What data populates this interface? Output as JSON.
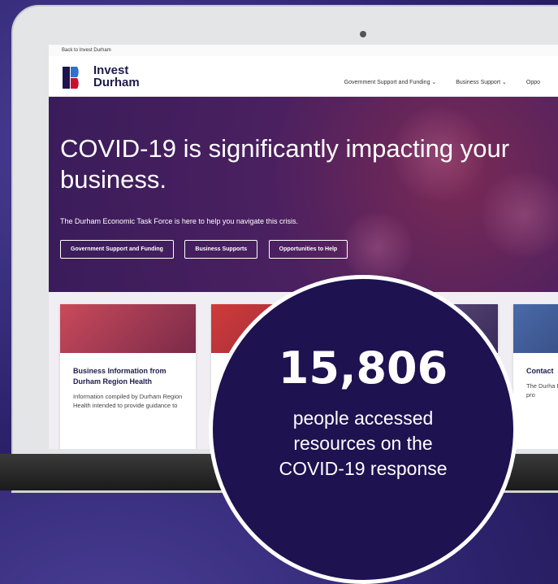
{
  "topbar": {
    "back_link": "Back to Invest Durham"
  },
  "logo": {
    "line1": "Invest",
    "line2": "Durham"
  },
  "nav": {
    "items": [
      "Government Support and Funding ⌄",
      "Business Support ⌄",
      "Oppo"
    ]
  },
  "hero": {
    "title": "COVID-19 is significantly impacting your business.",
    "subtitle": "The Durham Economic Task Force is here to help you navigate this crisis.",
    "buttons": [
      "Government Support and Funding",
      "Business Supports",
      "Opportunities to Help"
    ]
  },
  "cards": [
    {
      "title": "Business Information from Durham Region Health",
      "body": "Information compiled by Durham Region Health intended to provide guidance to"
    },
    {
      "title": "Contact",
      "body": "The Durha Force is he business. about pro"
    }
  ],
  "stat": {
    "number": "15,806",
    "line1": "people accessed",
    "line2": "resources on the",
    "line3": "COVID-19 response"
  },
  "colors": {
    "brand_navy": "#1e1250",
    "hero_purple": "#4a2060",
    "accent_red": "#c8102e"
  }
}
